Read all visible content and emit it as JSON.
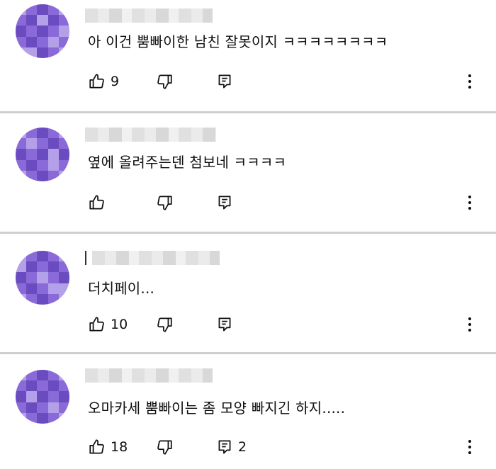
{
  "comments": [
    {
      "text": "아 이건 뿜빠이한 남친 잘못이지 ㅋㅋㅋㅋㅋㅋㅋㅋ",
      "likes": "9",
      "replies": ""
    },
    {
      "text": "옆에 올려주는덴 첨보네 ㅋㅋㅋㅋ",
      "likes": "",
      "replies": ""
    },
    {
      "text": "더치페이...",
      "likes": "10",
      "replies": ""
    },
    {
      "text": "오마카세 뿜빠이는 좀 모양 빠지긴 하지.....",
      "likes": "18",
      "replies": "2"
    }
  ],
  "icons": {
    "like": "thumbs-up-icon",
    "dislike": "thumbs-down-icon",
    "reply": "reply-icon",
    "more": "more-vert-icon"
  },
  "colors": {
    "avatar_dark": "#6a4cc0",
    "avatar_mid": "#8a6ad8",
    "avatar_light": "#b3a0e8",
    "divider": "#cfcfcf"
  }
}
